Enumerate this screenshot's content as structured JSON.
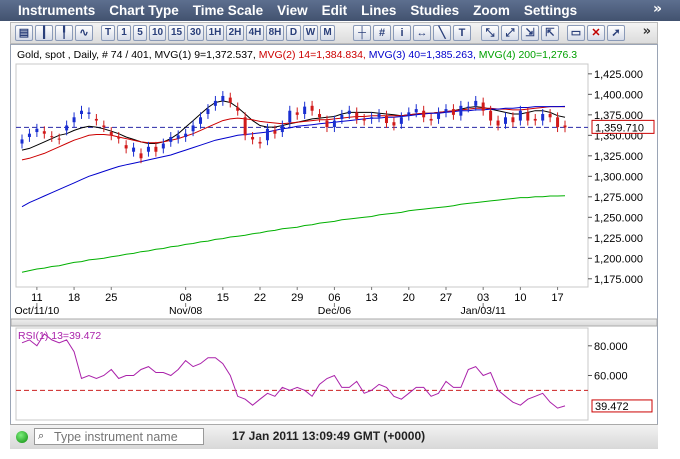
{
  "menu": [
    "Instruments",
    "Chart Type",
    "Time Scale",
    "View",
    "Edit",
    "Lines",
    "Studies",
    "Zoom",
    "Settings"
  ],
  "menu_more": "»",
  "toolbar": {
    "timeframes": [
      "T",
      "1",
      "5",
      "10",
      "15",
      "30",
      "1H",
      "2H",
      "4H",
      "8H",
      "D",
      "W",
      "M"
    ],
    "more": "»"
  },
  "chart_data": [
    {
      "type": "candlestick",
      "header": [
        {
          "text": "Gold, spot , Daily, # 74 / 401, MVG(1) 9=1,372.537, ",
          "color": "#000000"
        },
        {
          "text": "MVG(2) 14=1,384.834, ",
          "color": "#cc0000"
        },
        {
          "text": "MVG(3) 40=1,385.263, ",
          "color": "#0000cc"
        },
        {
          "text": "MVG(4) 200=1,276.3",
          "color": "#00a000"
        }
      ],
      "ylim": [
        1165,
        1437
      ],
      "yticks": [
        1175,
        1200,
        1225,
        1250,
        1275,
        1300,
        1325,
        1350,
        1375,
        1400,
        1425
      ],
      "ytick_labels": [
        "1,175.000",
        "1,200.000",
        "1,225.000",
        "1,250.000",
        "1,275.000",
        "1,300.000",
        "1,325.000",
        "1,350.000",
        "1,375.000",
        "1,400.000",
        "1,425.000"
      ],
      "x_day_labels": [
        "11",
        "18",
        "25",
        "08",
        "15",
        "22",
        "29",
        "06",
        "13",
        "20",
        "27",
        "03",
        "10",
        "17"
      ],
      "x_day_index": [
        2,
        7,
        12,
        22,
        27,
        32,
        37,
        42,
        47,
        52,
        57,
        62,
        67,
        72
      ],
      "x_period_labels": [
        "Oct/11/10",
        "Nov/08",
        "Dec/06",
        "Jan/03/11"
      ],
      "x_period_index": [
        2,
        22,
        42,
        62
      ],
      "n_days": 74,
      "last_price": 1359.71,
      "last_price_label": "1,359.710",
      "candles_close": [
        1345,
        1352,
        1358,
        1352,
        1348,
        1345,
        1362,
        1372,
        1380,
        1378,
        1368,
        1360,
        1350,
        1346,
        1334,
        1335,
        1322,
        1336,
        1330,
        1340,
        1348,
        1350,
        1352,
        1362,
        1372,
        1382,
        1392,
        1398,
        1390,
        1380,
        1350,
        1345,
        1340,
        1358,
        1352,
        1362,
        1380,
        1375,
        1385,
        1380,
        1372,
        1360,
        1368,
        1375,
        1380,
        1370,
        1368,
        1372,
        1376,
        1365,
        1362,
        1372,
        1378,
        1382,
        1372,
        1368,
        1378,
        1382,
        1375,
        1386,
        1385,
        1392,
        1380,
        1368,
        1362,
        1372,
        1366,
        1380,
        1368,
        1368,
        1376,
        1372,
        1360,
        1359.71
      ],
      "candles_open": [
        1340,
        1348,
        1354,
        1355,
        1349,
        1346,
        1356,
        1366,
        1376,
        1376,
        1370,
        1362,
        1354,
        1348,
        1338,
        1330,
        1328,
        1330,
        1336,
        1334,
        1342,
        1346,
        1348,
        1355,
        1364,
        1376,
        1386,
        1392,
        1396,
        1384,
        1372,
        1348,
        1342,
        1344,
        1356,
        1354,
        1366,
        1378,
        1376,
        1386,
        1376,
        1368,
        1360,
        1370,
        1376,
        1378,
        1370,
        1370,
        1372,
        1374,
        1366,
        1364,
        1374,
        1378,
        1380,
        1370,
        1370,
        1378,
        1382,
        1374,
        1384,
        1386,
        1390,
        1380,
        1368,
        1364,
        1372,
        1368,
        1378,
        1370,
        1368,
        1376,
        1372,
        1362
      ],
      "mvg": [
        {
          "name": "MVG(1) 9",
          "color": "#000000",
          "values": [
            1332,
            1334,
            1338,
            1342,
            1346,
            1350,
            1352,
            1356,
            1359,
            1361,
            1360,
            1358,
            1355,
            1352,
            1348,
            1345,
            1342,
            1340,
            1340,
            1342,
            1346,
            1352,
            1360,
            1368,
            1376,
            1384,
            1390,
            1392,
            1390,
            1384,
            1376,
            1368,
            1362,
            1360,
            1360,
            1362,
            1364,
            1366,
            1368,
            1370,
            1371,
            1372,
            1373,
            1376,
            1378,
            1378,
            1378,
            1378,
            1377,
            1376,
            1375,
            1374,
            1375,
            1376,
            1377,
            1377,
            1378,
            1379,
            1380,
            1382,
            1384,
            1385,
            1384,
            1382,
            1380,
            1378,
            1376,
            1376,
            1378,
            1380,
            1380,
            1378,
            1374,
            1372
          ]
        },
        {
          "name": "MVG(2) 14",
          "color": "#cc0000",
          "values": [
            1320,
            1322,
            1325,
            1328,
            1332,
            1336,
            1340,
            1344,
            1347,
            1350,
            1351,
            1351,
            1350,
            1348,
            1346,
            1344,
            1342,
            1341,
            1341,
            1342,
            1344,
            1346,
            1349,
            1352,
            1356,
            1360,
            1364,
            1368,
            1370,
            1371,
            1370,
            1369,
            1367,
            1366,
            1365,
            1364,
            1365,
            1366,
            1367,
            1368,
            1369,
            1369,
            1370,
            1371,
            1372,
            1373,
            1373,
            1374,
            1374,
            1374,
            1374,
            1374,
            1375,
            1376,
            1377,
            1377,
            1378,
            1379,
            1380,
            1381,
            1382,
            1383,
            1383,
            1383,
            1382,
            1382,
            1381,
            1381,
            1382,
            1383,
            1384,
            1385,
            1385,
            1384.8
          ]
        },
        {
          "name": "MVG(3) 40",
          "color": "#0000cc",
          "values": [
            1263,
            1268,
            1272,
            1276,
            1280,
            1284,
            1288,
            1292,
            1296,
            1300,
            1303,
            1306,
            1309,
            1312,
            1314,
            1316,
            1318,
            1320,
            1322,
            1324,
            1326,
            1329,
            1332,
            1335,
            1338,
            1341,
            1344,
            1346,
            1348,
            1350,
            1351,
            1352,
            1353,
            1354,
            1356,
            1358,
            1359,
            1361,
            1362,
            1363,
            1364,
            1365,
            1366,
            1367,
            1368,
            1369,
            1370,
            1371,
            1371,
            1372,
            1372,
            1373,
            1374,
            1375,
            1376,
            1377,
            1377,
            1378,
            1379,
            1380,
            1380,
            1381,
            1381,
            1382,
            1382,
            1383,
            1383,
            1384,
            1384,
            1385,
            1385,
            1385,
            1385,
            1385.3
          ]
        },
        {
          "name": "MVG(4) 200",
          "color": "#00b000",
          "values": [
            1183,
            1185,
            1187,
            1188,
            1190,
            1191,
            1193,
            1195,
            1196,
            1198,
            1199,
            1200,
            1202,
            1203,
            1205,
            1206,
            1208,
            1209,
            1211,
            1212,
            1214,
            1215,
            1217,
            1218,
            1220,
            1221,
            1223,
            1224,
            1226,
            1227,
            1228,
            1230,
            1231,
            1233,
            1234,
            1236,
            1237,
            1238,
            1240,
            1241,
            1243,
            1244,
            1245,
            1247,
            1248,
            1249,
            1250,
            1251,
            1253,
            1254,
            1255,
            1256,
            1258,
            1259,
            1260,
            1261,
            1262,
            1263,
            1264,
            1266,
            1267,
            1268,
            1269,
            1270,
            1271,
            1272,
            1273,
            1274,
            1274,
            1275,
            1275,
            1276,
            1276,
            1276.3
          ]
        }
      ]
    },
    {
      "type": "line",
      "title": "RSI(1) 13=39.472",
      "ylim": [
        30,
        92
      ],
      "yticks": [
        60,
        80
      ],
      "ytick_labels": [
        "60.000",
        "80.000"
      ],
      "reference_level": 50,
      "last_value_label": "39.472",
      "color": "#aa22aa",
      "values": [
        82,
        84,
        80,
        88,
        84,
        82,
        84,
        76,
        58,
        60,
        58,
        60,
        64,
        58,
        60,
        60,
        64,
        66,
        62,
        62,
        60,
        64,
        70,
        66,
        68,
        72,
        72,
        68,
        60,
        46,
        44,
        40,
        44,
        48,
        46,
        52,
        50,
        52,
        50,
        46,
        54,
        58,
        60,
        52,
        52,
        56,
        48,
        50,
        54,
        52,
        46,
        44,
        48,
        52,
        52,
        46,
        48,
        56,
        52,
        52,
        64,
        66,
        60,
        62,
        50,
        46,
        42,
        40,
        44,
        46,
        48,
        42,
        38,
        39.472
      ]
    }
  ],
  "status": {
    "search_placeholder": "Type instrument name",
    "timestamp": "17 Jan 2011 13:09:49  GMT (+0000)"
  }
}
